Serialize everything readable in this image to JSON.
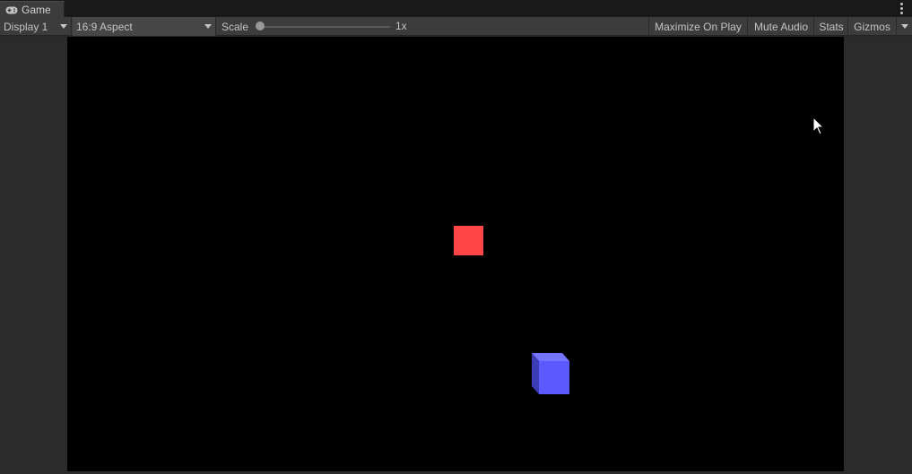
{
  "tab": {
    "title": "Game",
    "icon": "gamepad-icon"
  },
  "toolbar": {
    "display": "Display 1",
    "aspect": "16:9 Aspect",
    "scale_label": "Scale",
    "scale_value": "1x",
    "maximize_on_play": "Maximize On Play",
    "mute_audio": "Mute Audio",
    "stats": "Stats",
    "gizmos": "Gizmos"
  },
  "scene": {
    "background": "#000000",
    "objects": [
      {
        "name": "red-square",
        "color": "#ff4646"
      },
      {
        "name": "blue-cube",
        "color": "#5a5aff"
      }
    ]
  },
  "colors": {
    "panel": "#282828",
    "toolbar": "#3c3c3c",
    "text": "#c4c4c4"
  }
}
